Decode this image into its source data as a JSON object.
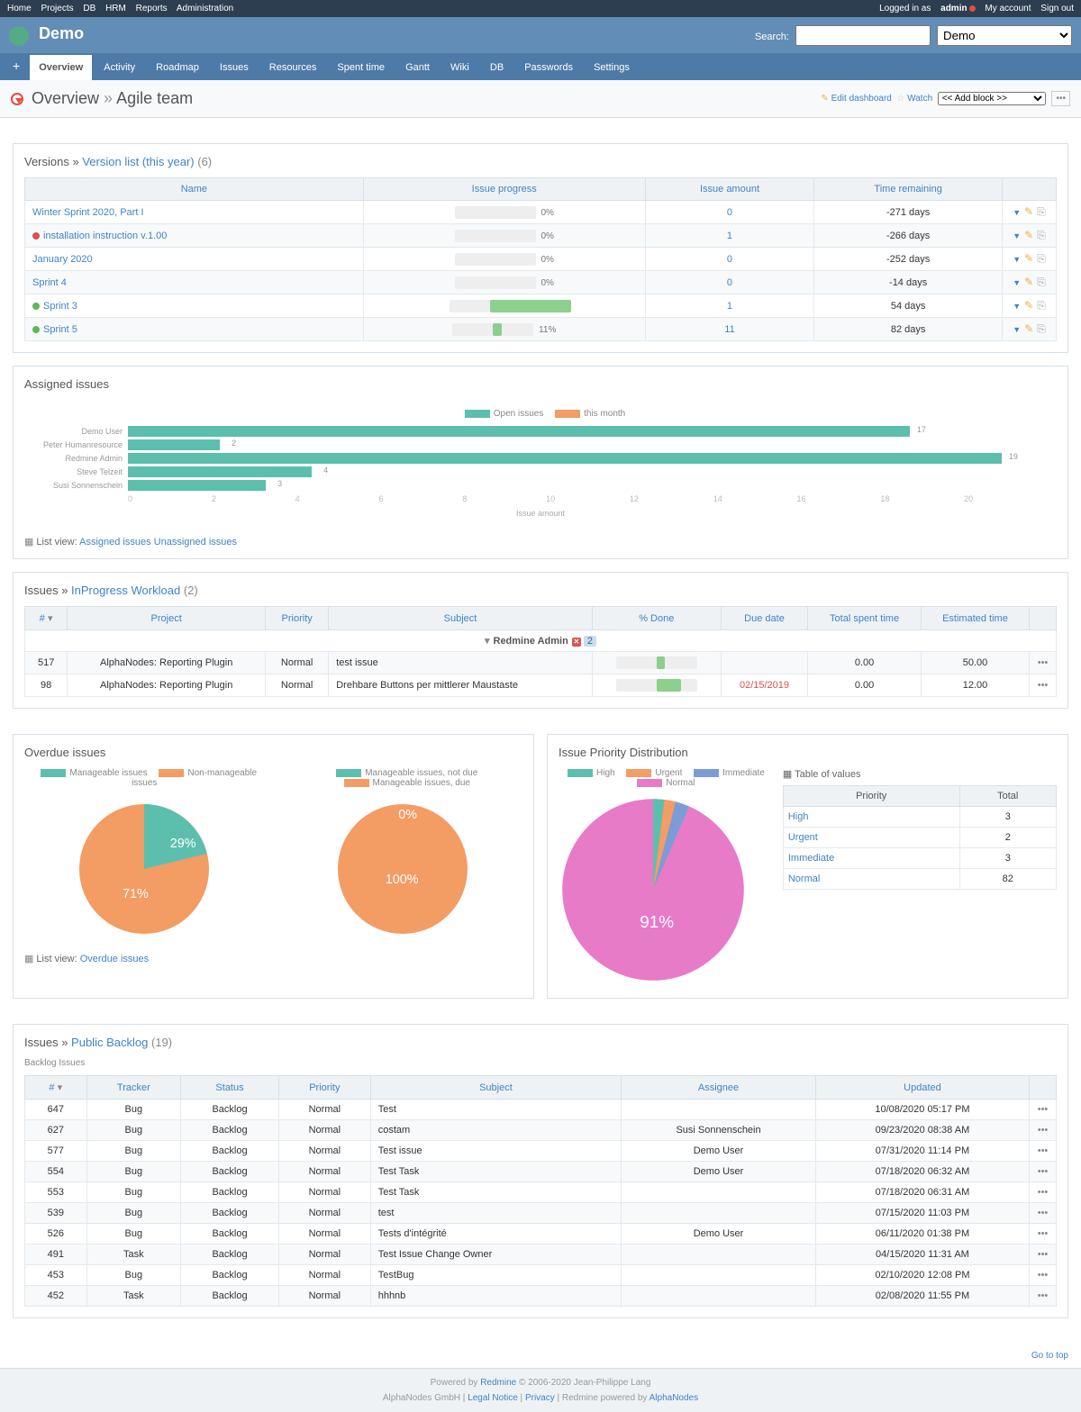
{
  "top_nav": {
    "left": [
      "Home",
      "Projects",
      "DB",
      "HRM",
      "Reports",
      "Administration"
    ],
    "login_prefix": "Logged in as ",
    "login_user": "admin",
    "right": [
      "My account",
      "Sign out"
    ]
  },
  "header": {
    "title": "Demo",
    "search_label": "Search:",
    "project_selector": "Demo"
  },
  "mainmenu": [
    "Overview",
    "Activity",
    "Roadmap",
    "Issues",
    "Resources",
    "Spent time",
    "Gantt",
    "Wiki",
    "DB",
    "Passwords",
    "Settings"
  ],
  "page_header": {
    "title_main": "Overview",
    "sep": " » ",
    "title_sub": "Agile team",
    "edit_dashboard": "Edit dashboard",
    "watch": "Watch",
    "add_block": "<< Add block >>"
  },
  "versions": {
    "title_a": "Versions",
    "title_b": "Version list (this year)",
    "count": "(6)",
    "cols": [
      "Name",
      "Issue progress",
      "Issue amount",
      "Time remaining"
    ],
    "rows": [
      {
        "dot": "",
        "name": "Winter Sprint 2020, Part I",
        "progress": 0,
        "amount": "0",
        "remain": "-271 days"
      },
      {
        "dot": "red",
        "name": "installation instruction v.1.00",
        "progress": 0,
        "amount": "1",
        "remain": "-266 days"
      },
      {
        "dot": "",
        "name": "January 2020",
        "progress": 0,
        "amount": "0",
        "remain": "-252 days"
      },
      {
        "dot": "",
        "name": "Sprint 4",
        "progress": 0,
        "amount": "0",
        "remain": "-14 days"
      },
      {
        "dot": "green",
        "name": "Sprint 3",
        "progress": 100,
        "amount": "1",
        "remain": "54 days"
      },
      {
        "dot": "green",
        "name": "Sprint 5",
        "progress": 11,
        "amount": "11",
        "remain": "82 days"
      }
    ]
  },
  "assigned": {
    "title": "Assigned issues",
    "legend": [
      "Open issues",
      "this month"
    ],
    "chart_data": {
      "type": "bar",
      "orientation": "horizontal",
      "xlabel": "Issue amount",
      "xlim": [
        0,
        20
      ],
      "xticks": [
        0,
        2,
        4,
        6,
        8,
        10,
        12,
        14,
        16,
        18,
        20
      ],
      "series": [
        {
          "name": "Open issues",
          "color": "#5cbfad"
        },
        {
          "name": "this month",
          "color": "#f39c64"
        }
      ],
      "categories": [
        "Demo User",
        "Peter Humanresource",
        "Redmine Admin",
        "Steve Telzeit",
        "Susi Sonnenschein"
      ],
      "values": [
        17,
        2,
        19,
        4,
        3
      ]
    },
    "list_view_label": "List view:",
    "list_links": [
      "Assigned issues",
      "Unassigned issues"
    ]
  },
  "inprogress": {
    "title_a": "Issues",
    "title_b": "InProgress Workload",
    "count": "(2)",
    "cols": [
      "#",
      "Project",
      "Priority",
      "Subject",
      "% Done",
      "Due date",
      "Total spent time",
      "Estimated time"
    ],
    "group": "Redmine Admin",
    "rows": [
      {
        "id": "517",
        "project": "AlphaNodes: Reporting Plugin",
        "priority": "Normal",
        "subject": "test issue",
        "done": 10,
        "due": "",
        "spent": "0.00",
        "est": "50.00"
      },
      {
        "id": "98",
        "project": "AlphaNodes: Reporting Plugin",
        "priority": "Normal",
        "subject": "Drehbare Buttons per mittlerer Maustaste",
        "done": 30,
        "due": "02/15/2019",
        "due_overdue": true,
        "spent": "0.00",
        "est": "12.00"
      }
    ]
  },
  "overdue": {
    "title": "Overdue issues",
    "legend1": [
      "Manageable issues",
      "Non-manageable issues"
    ],
    "legend2": [
      "Manageable issues, not due",
      "Manageable issues, due"
    ],
    "chart_data": [
      {
        "type": "pie",
        "title": "",
        "series": [
          {
            "name": "Manageable issues",
            "value": 29,
            "label": "29%",
            "color": "#5cbfad"
          },
          {
            "name": "Non-manageable issues",
            "value": 71,
            "label": "71%",
            "color": "#f39c64"
          }
        ]
      },
      {
        "type": "pie",
        "title": "",
        "series": [
          {
            "name": "Manageable issues, not due",
            "value": 0,
            "label": "0%",
            "color": "#5cbfad"
          },
          {
            "name": "Manageable issues, due",
            "value": 100,
            "label": "100%",
            "color": "#f39c64"
          }
        ]
      }
    ],
    "list_view_label": "List view:",
    "list_link": "Overdue issues"
  },
  "priority_dist": {
    "title": "Issue Priority Distribution",
    "legend": [
      "High",
      "Urgent",
      "Immediate",
      "Normal"
    ],
    "chart_data": {
      "type": "pie",
      "series": [
        {
          "name": "High",
          "value": 3,
          "color": "#5cbfad"
        },
        {
          "name": "Urgent",
          "value": 2,
          "color": "#f39c64"
        },
        {
          "name": "Immediate",
          "value": 3,
          "color": "#7b9cd6"
        },
        {
          "name": "Normal",
          "value": 82,
          "label": "91%",
          "color": "#e77bc8"
        }
      ]
    },
    "table_title": "Table of values",
    "table_cols": [
      "Priority",
      "Total"
    ],
    "table_rows": [
      {
        "p": "High",
        "t": "3"
      },
      {
        "p": "Urgent",
        "t": "2"
      },
      {
        "p": "Immediate",
        "t": "3"
      },
      {
        "p": "Normal",
        "t": "82"
      }
    ]
  },
  "backlog": {
    "title_a": "Issues",
    "title_b": "Public Backlog",
    "count": "(19)",
    "subtitle": "Backlog Issues",
    "cols": [
      "#",
      "Tracker",
      "Status",
      "Priority",
      "Subject",
      "Assignee",
      "Updated"
    ],
    "rows": [
      {
        "id": "647",
        "tr": "Bug",
        "st": "Backlog",
        "pr": "Normal",
        "sub": "Test",
        "as": "",
        "up": "10/08/2020 05:17 PM"
      },
      {
        "id": "627",
        "tr": "Bug",
        "st": "Backlog",
        "pr": "Normal",
        "sub": "costam",
        "as": "Susi Sonnenschein",
        "up": "09/23/2020 08:38 AM"
      },
      {
        "id": "577",
        "tr": "Bug",
        "st": "Backlog",
        "pr": "Normal",
        "sub": "Test issue",
        "as": "Demo User",
        "up": "07/31/2020 11:14 PM"
      },
      {
        "id": "554",
        "tr": "Bug",
        "st": "Backlog",
        "pr": "Normal",
        "sub": "Test Task",
        "as": "Demo User",
        "up": "07/18/2020 06:32 AM"
      },
      {
        "id": "553",
        "tr": "Bug",
        "st": "Backlog",
        "pr": "Normal",
        "sub": "Test Task",
        "as": "",
        "up": "07/18/2020 06:31 AM"
      },
      {
        "id": "539",
        "tr": "Bug",
        "st": "Backlog",
        "pr": "Normal",
        "sub": "test",
        "as": "",
        "up": "07/15/2020 11:03 PM"
      },
      {
        "id": "526",
        "tr": "Bug",
        "st": "Backlog",
        "pr": "Normal",
        "sub": "Tests d'intégrité",
        "as": "Demo User",
        "up": "06/11/2020 01:38 PM"
      },
      {
        "id": "491",
        "tr": "Task",
        "st": "Backlog",
        "pr": "Normal",
        "sub": "Test Issue Change Owner",
        "as": "",
        "up": "04/15/2020 11:31 AM"
      },
      {
        "id": "453",
        "tr": "Bug",
        "st": "Backlog",
        "pr": "Normal",
        "sub": "TestBug",
        "as": "",
        "up": "02/10/2020 12:08 PM"
      },
      {
        "id": "452",
        "tr": "Task",
        "st": "Backlog",
        "pr": "Normal",
        "sub": "hhhnb",
        "as": "",
        "up": "02/08/2020 11:55 PM"
      }
    ]
  },
  "gotop": "Go to top",
  "footer": {
    "l1a": "Powered by ",
    "l1b": "Redmine",
    "l1c": " © 2006-2020 Jean-Philippe Lang",
    "l2a": "AlphaNodes GmbH | ",
    "l2_links": [
      "Legal Notice",
      "Privacy"
    ],
    "l2b": " | Redmine powered by ",
    "l2c": "AlphaNodes"
  }
}
